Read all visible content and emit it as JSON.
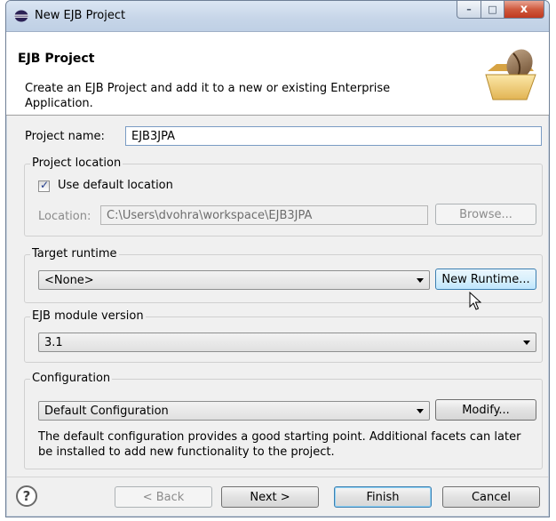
{
  "window": {
    "title": "New EJB Project",
    "controls": {
      "minimize": "–",
      "maximize": "□",
      "close": "x"
    }
  },
  "header": {
    "title": "EJB Project",
    "description": "Create an EJB Project and add it to a new or existing Enterprise Application."
  },
  "project_name": {
    "label": "Project name:",
    "value": "EJB3JPA"
  },
  "project_location": {
    "group_title": "Project location",
    "use_default_label": "Use default location",
    "use_default_checked": true,
    "location_label": "Location:",
    "location_value": "C:\\Users\\dvohra\\workspace\\EJB3JPA",
    "browse_label": "Browse..."
  },
  "target_runtime": {
    "group_title": "Target runtime",
    "selected": "<None>",
    "new_runtime_label": "New Runtime..."
  },
  "ejb_module_version": {
    "group_title": "EJB module version",
    "selected": "3.1"
  },
  "configuration": {
    "group_title": "Configuration",
    "selected": "Default Configuration",
    "modify_label": "Modify...",
    "description": "The default configuration provides a good starting point. Additional facets can later be installed to add new functionality to the project."
  },
  "footer": {
    "help_glyph": "?",
    "back_label": "< Back",
    "next_label": "Next >",
    "finish_label": "Finish",
    "cancel_label": "Cancel"
  },
  "icons": {
    "window": "eclipse-icon",
    "header": "folder-bean-icon",
    "help": "help-icon"
  }
}
